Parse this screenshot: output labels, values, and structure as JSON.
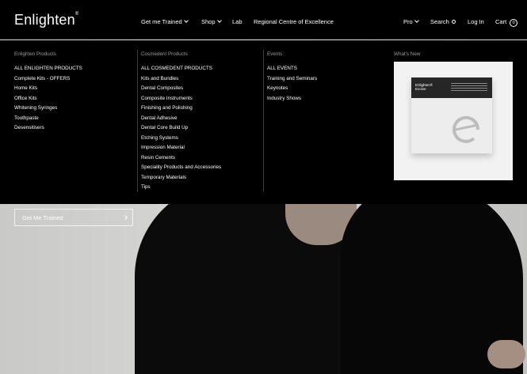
{
  "header": {
    "logo": "Enlighten",
    "logo_mark": "®",
    "nav": [
      {
        "label": "Get me Trained",
        "has_dropdown": true
      },
      {
        "label": "Shop",
        "has_dropdown": true
      },
      {
        "label": "Lab",
        "has_dropdown": false
      },
      {
        "label": "Regional Centre of Excellence",
        "has_dropdown": false
      }
    ],
    "pro_label": "Pro",
    "search_label": "Search",
    "login_label": "Log In",
    "cart_label": "Cart",
    "cart_count": "0"
  },
  "menu": {
    "enlighten": {
      "title": "Enlighten Products",
      "items": [
        "ALL ENLIGHTEN PRODUCTS",
        "Complete Kits - OFFERS",
        "Home Kits",
        "Office Kits",
        "Whitening Syringes",
        "Toothpaste",
        "Desensitisers"
      ]
    },
    "cosmedent": {
      "title": "Cosmedent Products",
      "items": [
        "ALL COSMEDENT PRODUCTS",
        "Kits and Bundles",
        "Dental Composites",
        "Composite Instruments",
        "Finishing and Polishing",
        "Dental Adhesive",
        "Dental Core Build Up",
        "Etching Systems",
        "Impression Material",
        "Resin Cements",
        "Speciality Products and Accessories",
        "Temporary Materials",
        "Tips"
      ]
    },
    "events": {
      "title": "Events",
      "items": [
        "ALL EVENTS",
        "Training and Seminars",
        "Keynotes",
        "Industry Shows"
      ]
    },
    "whats_new": {
      "title": "What's New",
      "promo_brand": "Enlighten®",
      "promo_product": "Evolve"
    }
  },
  "hero": {
    "cta_label": "Get Me Trained"
  },
  "colors": {
    "header_bg": "#000000",
    "text": "#ffffff",
    "muted": "#9a9a9a"
  }
}
